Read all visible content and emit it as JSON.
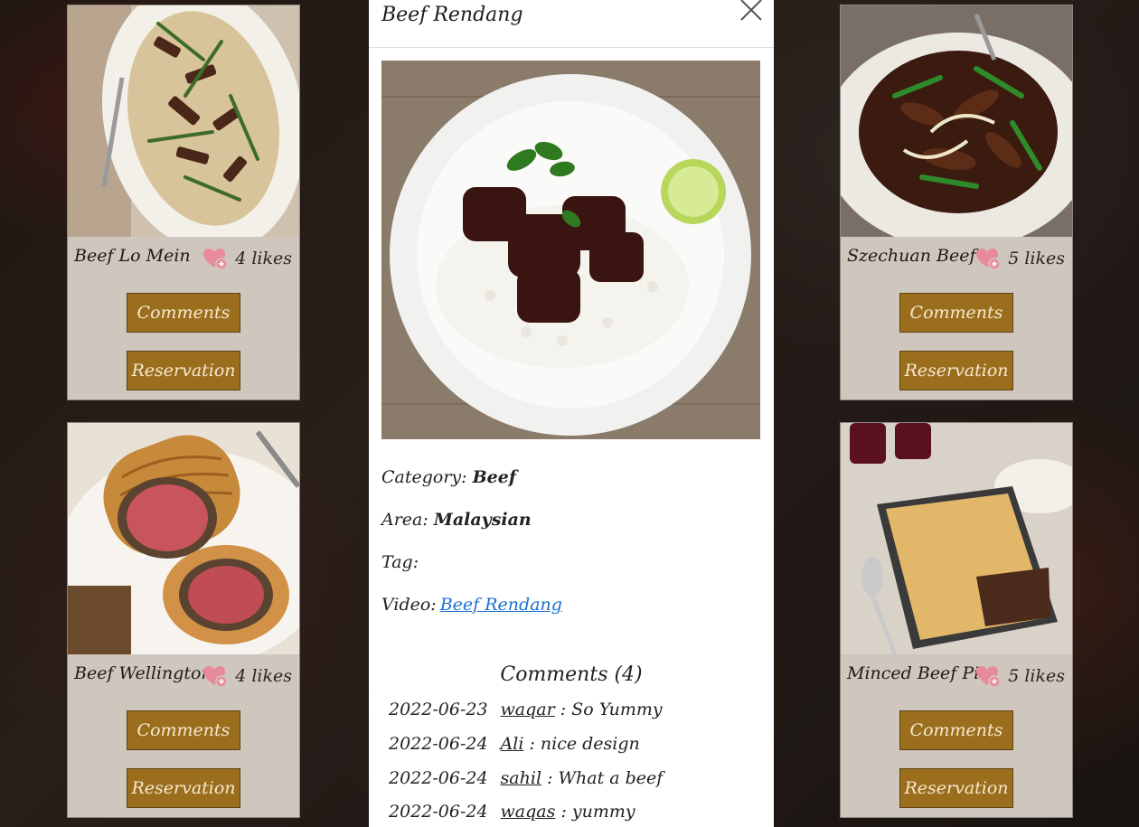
{
  "cards": [
    {
      "name": "Beef Lo Mein",
      "likes": "4 likes",
      "comments_label": "Comments",
      "reservation_label": "Reservation"
    },
    {
      "name": "Beef Wellington",
      "likes": "4 likes",
      "comments_label": "Comments",
      "reservation_label": "Reservation"
    },
    {
      "name": "Szechuan Beef",
      "likes": "5 likes",
      "comments_label": "Comments",
      "reservation_label": "Reservation"
    },
    {
      "name": "Minced Beef Pie",
      "likes": "5 likes",
      "comments_label": "Comments",
      "reservation_label": "Reservation"
    }
  ],
  "modal": {
    "title": "Beef Rendang",
    "category_label": "Category:",
    "category": "Beef",
    "area_label": "Area:",
    "area": "Malaysian",
    "tag_label": "Tag:",
    "video_label": "Video:",
    "video_link": "Beef Rendang",
    "comments_title": "Comments (4)",
    "comments": [
      {
        "date": "2022-06-23",
        "user": "waqar",
        "text": ": So Yummy"
      },
      {
        "date": "2022-06-24",
        "user": "Ali",
        "text": ": nice design"
      },
      {
        "date": "2022-06-24",
        "user": "sahil",
        "text": ": What a beef"
      },
      {
        "date": "2022-06-24",
        "user": "waqas",
        "text": ": yummy"
      }
    ]
  },
  "colors": {
    "button": "#9b6e1e",
    "card": "#cfc6bd",
    "link": "#1a6fd6"
  }
}
